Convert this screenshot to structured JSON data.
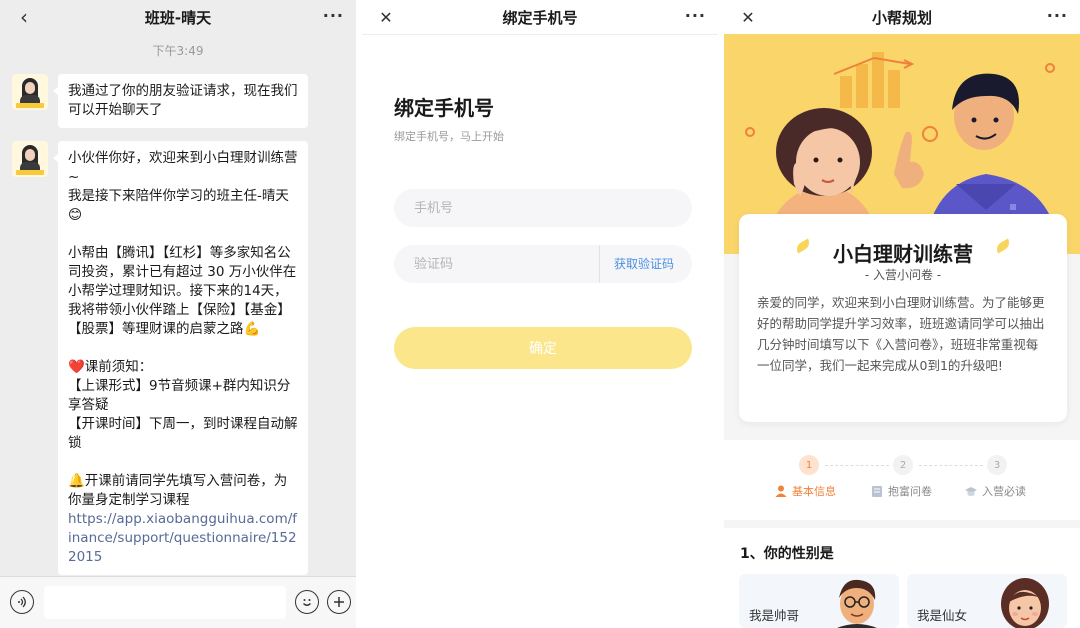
{
  "chat": {
    "title": "班班-晴天",
    "back_icon": "‹",
    "more_icon": "···",
    "time": "下午3:49",
    "msg1": "我通过了你的朋友验证请求，现在我们可以开始聊天了",
    "msg2": {
      "p1": "小伙伴你好，欢迎来到小白理财训练营~",
      "p2": "我是接下来陪伴你学习的班主任-晴天😊",
      "p3": "小帮由【腾讯】【红杉】等多家知名公司投资，累计已有超过 30 万小伙伴在小帮学过理财知识。接下来的14天，我将带领小伙伴踏上【保险】【基金】【股票】等理财课的启蒙之路💪",
      "p4": "❤️课前须知：",
      "p5": "【上课形式】9节音频课+群内知识分享答疑",
      "p6": "【开课时间】下周一，到时课程自动解锁",
      "p7": "🔔开课前请同学先填写入营问卷，为你量身定制学习课程",
      "link": "https://app.xiaobangguihua.com/finance/support/questionnaire/1522015"
    }
  },
  "bind": {
    "nav_title": "绑定手机号",
    "close_icon": "✕",
    "more_icon": "···",
    "title": "绑定手机号",
    "subtitle": "绑定手机号，马上开始",
    "phone_placeholder": "手机号",
    "code_placeholder": "验证码",
    "get_code_label": "获取验证码",
    "confirm_label": "确定"
  },
  "survey": {
    "nav_title": "小帮规划",
    "close_icon": "✕",
    "more_icon": "···",
    "card_title": "小白理财训练营",
    "card_subtitle": "- 入营小问卷 -",
    "card_body": "亲爱的同学，欢迎来到小白理财训练营。为了能够更好的帮助同学提升学习效率，班班邀请同学可以抽出几分钟时间填写以下《入营问卷》，班班非常重视每一位同学，我们一起来完成从0到1的升级吧!",
    "steps": [
      {
        "num": "1",
        "label": "基本信息"
      },
      {
        "num": "2",
        "label": "抱富问卷"
      },
      {
        "num": "3",
        "label": "入营必读"
      }
    ],
    "question": "1、你的性别是",
    "options": [
      "我是帅哥",
      "我是仙女"
    ],
    "accent_color": "#f0813b"
  }
}
